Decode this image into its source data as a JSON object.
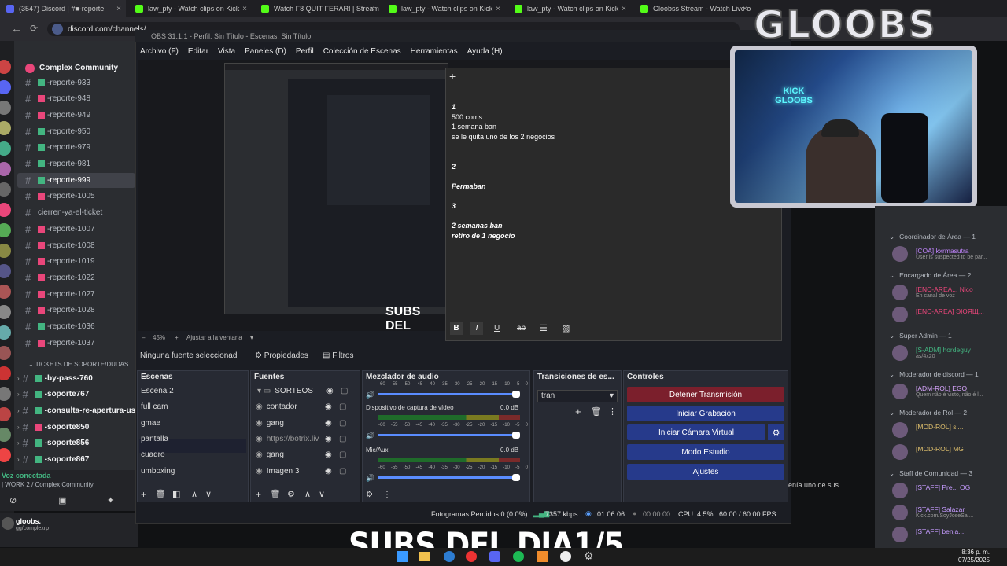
{
  "browser": {
    "tabs": [
      {
        "label": "(3547) Discord | #■-reporte",
        "color": "#5865f2"
      },
      {
        "label": "law_pty - Watch clips on Kick",
        "color": "#53fc18"
      },
      {
        "label": "Watch F8 QUIT FERARI | Stream",
        "color": "#53fc18"
      },
      {
        "label": "law_pty - Watch clips on Kick",
        "color": "#53fc18"
      },
      {
        "label": "law_pty - Watch clips on Kick",
        "color": "#53fc18"
      },
      {
        "label": "Gloobss Stream - Watch Live o",
        "color": "#53fc18"
      }
    ],
    "url": "discord.com/channels/"
  },
  "discord": {
    "server_name": "Complex Community",
    "channels": [
      {
        "label": "-reporte-933",
        "color": "#43b581"
      },
      {
        "label": "-reporte-948",
        "color": "#e9467a"
      },
      {
        "label": "-reporte-949",
        "color": "#e9467a"
      },
      {
        "label": "-reporte-950",
        "color": "#43b581"
      },
      {
        "label": "-reporte-979",
        "color": "#43b581"
      },
      {
        "label": "-reporte-981",
        "color": "#43b581"
      },
      {
        "label": "-reporte-999",
        "color": "#43b581"
      },
      {
        "label": "-reporte-1005",
        "color": "#e9467a"
      },
      {
        "label": "cierren-ya-el-ticket",
        "color": ""
      },
      {
        "label": "-reporte-1007",
        "color": "#e9467a"
      },
      {
        "label": "-reporte-1008",
        "color": "#e9467a"
      },
      {
        "label": "-reporte-1019",
        "color": "#e9467a"
      },
      {
        "label": "-reporte-1022",
        "color": "#e9467a"
      },
      {
        "label": "-reporte-1027",
        "color": "#e9467a"
      },
      {
        "label": "-reporte-1028",
        "color": "#e9467a"
      },
      {
        "label": "-reporte-1036",
        "color": "#43b581"
      },
      {
        "label": "-reporte-1037",
        "color": "#e9467a"
      }
    ],
    "tickets_category": "TICKETS DE SOPORTE/DUDAS",
    "tickets": [
      {
        "label": "-by-pass-760",
        "color": "#43b581"
      },
      {
        "label": "-soporte767",
        "color": "#43b581"
      },
      {
        "label": "-consulta-re-apertura-us",
        "color": "#43b581"
      },
      {
        "label": "-soporte850",
        "color": "#e9467a"
      },
      {
        "label": "-soporte856",
        "color": "#43b581"
      },
      {
        "label": "-soporte867",
        "color": "#43b581"
      }
    ],
    "voice_status": "Voz conectada",
    "voice_channel": "| WORK 2 / Complex Community",
    "username": "gloobs.",
    "user_status": "gg/complexrp"
  },
  "obs": {
    "title": "OBS 31.1.1 - Perfil: Sin Título - Escenas: Sin Título",
    "menu": [
      "Archivo (F)",
      "Editar",
      "Vista",
      "Paneles (D)",
      "Perfil",
      "Colección de Escenas",
      "Herramientas",
      "Ayuda (H)"
    ],
    "zoom": "45%",
    "fit": "Ajustar a la ventana",
    "no_source": "Ninguna fuente seleccionad",
    "props": "Propiedades",
    "filters": "Filtros",
    "scenes_title": "Escenas",
    "scenes": [
      "Escena 2",
      "full cam",
      "gmae",
      "pantalla",
      "cuadro",
      "umboxing"
    ],
    "sources_title": "Fuentes",
    "sources": [
      "SORTEOS",
      "contador",
      "gang",
      "https://botrix.liv",
      "gang",
      "Imagen 3"
    ],
    "mixer_title": "Mezclador de audio",
    "mixer": [
      {
        "name": "Dispositivo de captura de vídeo",
        "db": "0.0 dB"
      },
      {
        "name": "Mic/Aux",
        "db": "0.0 dB"
      }
    ],
    "mixer_scale": [
      "-60",
      "-55",
      "-50",
      "-45",
      "-40",
      "-35",
      "-30",
      "-25",
      "-20",
      "-15",
      "-10",
      "-5",
      "0"
    ],
    "transitions_title": "Transiciones de es...",
    "transition": "tran",
    "controls_title": "Controles",
    "controls": {
      "stop_stream": "Detener Transmisión",
      "record": "Iniciar Grabación",
      "vcam": "Iniciar Cámara Virtual",
      "studio": "Modo Estudio",
      "settings": "Ajustes"
    },
    "status": {
      "dropped": "Fotogramas Perdidos 0 (0.0%)",
      "kbps": "7357 kbps",
      "stream_time": "01:06:06",
      "rec_time": "00:00:00",
      "cpu": "CPU: 4.5%",
      "fps": "60.00 / 60.00 FPS"
    },
    "preview_text": "SUBS DEL"
  },
  "note": {
    "lines": [
      {
        "t": "1",
        "s": "bi"
      },
      {
        "t": "500 coms",
        "s": ""
      },
      {
        "t": "1 semana ban",
        "s": ""
      },
      {
        "t": "se le quita uno de los 2 negocios",
        "s": ""
      },
      {
        "t": "",
        "s": ""
      },
      {
        "t": "",
        "s": ""
      },
      {
        "t": "2",
        "s": "bi"
      },
      {
        "t": "",
        "s": ""
      },
      {
        "t": "Permaban",
        "s": "bi"
      },
      {
        "t": "",
        "s": ""
      },
      {
        "t": "3",
        "s": "bi"
      },
      {
        "t": "",
        "s": ""
      },
      {
        "t": "2 semanas ban",
        "s": "bi"
      },
      {
        "t": "retiro de 1 negocio",
        "s": "bi"
      }
    ]
  },
  "members": {
    "groups": [
      {
        "title": "Coordinador de Área — 1",
        "members": [
          {
            "name": "[COA] kxrmasutra",
            "sub": "User is suspected to be par...",
            "color": "#c084fc"
          }
        ]
      },
      {
        "title": "Encargado de Área — 2",
        "members": [
          {
            "name": "[ENC-AREA... Nico",
            "sub": "En canal de voz",
            "color": "#e9467a"
          },
          {
            "name": "[ENC-AREA] ЭЮЯЩ...",
            "sub": "",
            "color": "#e9467a"
          }
        ]
      },
      {
        "title": "Super Admin — 1",
        "members": [
          {
            "name": "[S-ADM] hordeguy",
            "sub": "as/4x20",
            "color": "#43b581"
          }
        ]
      },
      {
        "title": "Moderador de discord — 1",
        "members": [
          {
            "name": "[ADM-ROL] EGO",
            "sub": "Quem não é visto, não é l...",
            "color": "#d9a6ff"
          }
        ]
      },
      {
        "title": "Moderador de Rol — 2",
        "members": [
          {
            "name": "[MOD-ROL] si...",
            "sub": "",
            "color": "#e2c26e"
          },
          {
            "name": "[MOD-ROL] MG",
            "sub": "",
            "color": "#e2c26e"
          }
        ]
      },
      {
        "title": "Staff de Comunidad — 3",
        "members": [
          {
            "name": "[STAFF] Pre... OG",
            "sub": "",
            "color": "#c59bff"
          },
          {
            "name": "[STAFF] Salazar",
            "sub": "Kick.com/SoyJoseSal...",
            "color": "#c59bff"
          },
          {
            "name": "[STAFF] benja...",
            "sub": "",
            "color": "#c59bff"
          }
        ]
      }
    ]
  },
  "stream": {
    "brand": "GLOOBS",
    "sign": "KICK GLOOBS",
    "subs": "SUBS DEL DIA1/5",
    "chat_snippet": "enía uno de sus"
  },
  "taskbar": {
    "time": "8:36 p. m.",
    "date": "07/25/2025"
  }
}
